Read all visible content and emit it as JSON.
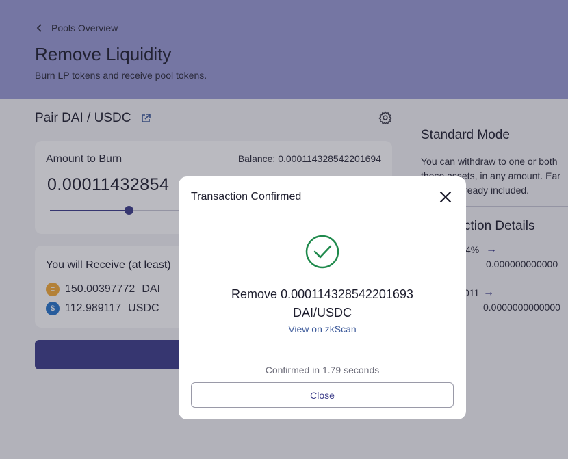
{
  "header": {
    "back_label": "Pools Overview",
    "title": "Remove Liquidity",
    "subtitle": "Burn LP tokens and receive pool tokens."
  },
  "pair": {
    "label": "Pair DAI / USDC"
  },
  "burn": {
    "label": "Amount to Burn",
    "balance": "Balance: 0.000114328542201694",
    "amount": "0.00011432854",
    "slider_value_fraction": 0.24
  },
  "receive": {
    "title": "You will Receive (at least)",
    "tokens": [
      {
        "amount": "150.00397772",
        "symbol": "DAI",
        "icon": "dai-coin-icon"
      },
      {
        "amount": "112.989117",
        "symbol": "USDC",
        "icon": "usdc-coin-icon"
      }
    ]
  },
  "side": {
    "title": "Standard Mode",
    "desc_lines": [
      "You can withdraw to one or both",
      "these assets, in any amount. Ear",
      "lready included."
    ],
    "details_title": "ction Details",
    "row1_left": "4%",
    "row1_arrow": "→",
    "row1_value": "0.000000000000",
    "row2_left": "011",
    "row2_arrow": "→",
    "row2_value": "0.0000000000000"
  },
  "modal": {
    "title": "Transaction Confirmed",
    "message_line1": "Remove 0.000114328542201693",
    "message_line2": "DAI/USDC",
    "link": "View on zkScan",
    "confirmed": "Confirmed in 1.79 seconds",
    "close_button": "Close"
  },
  "colors": {
    "header_bg": "#9a9bd4",
    "accent": "#3d3d8a",
    "success": "#1f8a4c",
    "dai": "#f5ac37",
    "usdc": "#2775ca"
  }
}
